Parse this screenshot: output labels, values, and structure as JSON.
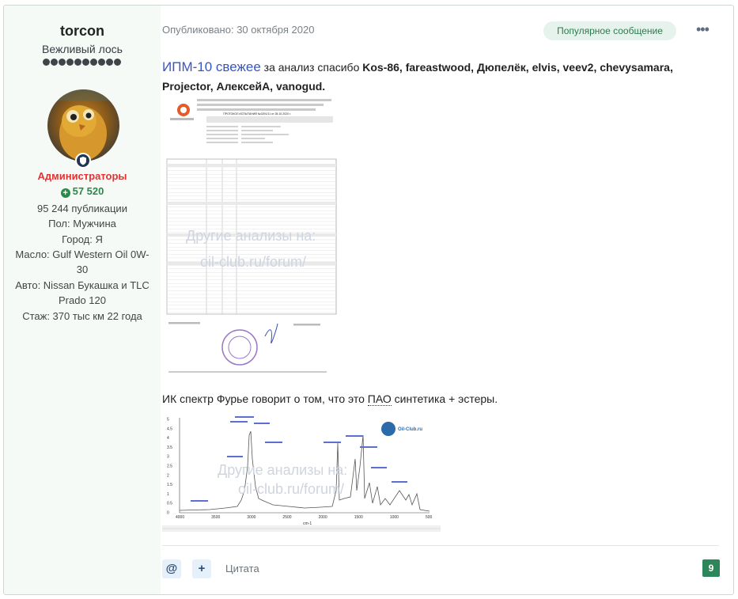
{
  "author": {
    "username": "torcon",
    "rank_title": "Вежливый лось",
    "pips": 10,
    "group": "Администраторы",
    "reputation": "57 520",
    "posts": "95 244 публикации",
    "gender": "Пол: Мужчина",
    "city": "Город: Я",
    "oil": "Масло: Gulf Western Oil 0W-30",
    "car": "Авто: Nissan Букашка и TLC Prado 120",
    "experience": "Стаж: 370 тыс км 22 года"
  },
  "post": {
    "published": "Опубликовано: 30 октября 2020",
    "popular_badge": "Популярное сообщение",
    "menu_icon": "ellipsis-icon",
    "link_text": "ИПМ-10 свежее",
    "thanks_prefix": " за анализ спасибо ",
    "thanks_names": "Kos-86, fareastwood, Дюпелёк, elvis, veev2, chevysamara, Projector, АлексейА, vanogud.",
    "spectrum_caption_pre": "ИК спектр Фурье говорит о том, что это ",
    "spectrum_caption_pao": "ПАО",
    "spectrum_caption_post": " синтетика + эстеры.",
    "doc_title": "ПРОТОКОЛ ИСПЫТАНИЙ №3291/11 от 28.10.2020 г.",
    "doc_watermark_1": "Другие анализы на:",
    "doc_watermark_2": "oil-club.ru/forum/",
    "spectrum_watermark_1": "Другие анализы на:",
    "spectrum_watermark_2": "oil-club.ru/forum/",
    "spectrum_logo": "Oil-Club.ru",
    "spectrum_xlabel": "cm-1",
    "spectrum_xticks": [
      "4000",
      "3500",
      "3000",
      "2500",
      "2000",
      "1500",
      "1000",
      "500"
    ],
    "spectrum_yticks": [
      "5",
      "4.5",
      "4",
      "3.5",
      "3",
      "2.5",
      "2",
      "1.5",
      "1",
      "0.5",
      "0"
    ]
  },
  "actions": {
    "mention_icon": "@",
    "add_icon": "+",
    "quote_label": "Цитата",
    "reaction_count": "9"
  }
}
